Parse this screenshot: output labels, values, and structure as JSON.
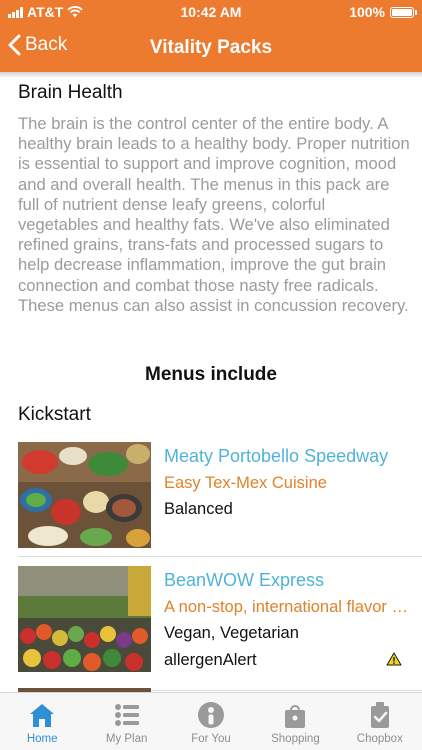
{
  "status": {
    "carrier": "AT&T",
    "time": "10:42 AM",
    "battery": "100%"
  },
  "nav": {
    "back_label": "Back",
    "title": "Vitality Packs"
  },
  "pack": {
    "title": "Brain Health",
    "description": "The brain is the control center of the entire body. A healthy brain leads to a healthy body. Proper nutrition is essential to support and improve cognition, mood and and overall health. The menus in this pack are full of nutrient dense leafy greens, colorful vegetables and healthy fats. We've also eliminated refined grains, trans-fats and processed sugars to help decrease inflammation, improve the gut brain connection and combat those nasty free radicals. These menus can also assist in concussion recovery."
  },
  "menus_heading": "Menus include",
  "section_label": "Kickstart",
  "menus": [
    {
      "name": "Meaty Portobello Speedway",
      "cuisine": "Easy Tex-Mex Cuisine",
      "tags": "Balanced",
      "allergen": ""
    },
    {
      "name": "BeanWOW Express",
      "cuisine": "A non-stop, international flavor tour",
      "tags": "Vegan, Vegetarian",
      "allergen": "allergenAlert"
    }
  ],
  "tabs": [
    {
      "label": "Home",
      "icon": "home-icon",
      "active": true
    },
    {
      "label": "My Plan",
      "icon": "list-icon",
      "active": false
    },
    {
      "label": "For You",
      "icon": "person-icon",
      "active": false
    },
    {
      "label": "Shopping",
      "icon": "shopping-bag-icon",
      "active": false
    },
    {
      "label": "Chopbox",
      "icon": "checked-box-icon",
      "active": false
    }
  ],
  "colors": {
    "brand": "#ec7a2f",
    "link": "#4fb3d9",
    "accent_text": "#e0822c",
    "active_tab": "#2f8fd6"
  }
}
